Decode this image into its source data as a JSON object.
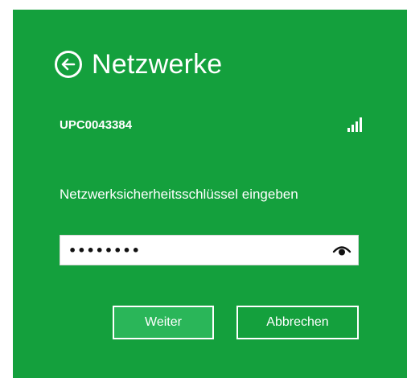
{
  "header": {
    "title": "Netzwerke"
  },
  "network": {
    "name": "UPC0043384",
    "signal_bars": 4
  },
  "password": {
    "label": "Netzwerksicherheitsschlüssel eingeben",
    "masked_value": "••••••••"
  },
  "buttons": {
    "next_label": "Weiter",
    "cancel_label": "Abbrechen"
  },
  "colors": {
    "background": "#14a03d",
    "primary_button": "#2ab659",
    "text": "#ffffff"
  },
  "icons": {
    "back": "arrow-left-circle",
    "signal": "signal-strength",
    "reveal": "eye"
  }
}
